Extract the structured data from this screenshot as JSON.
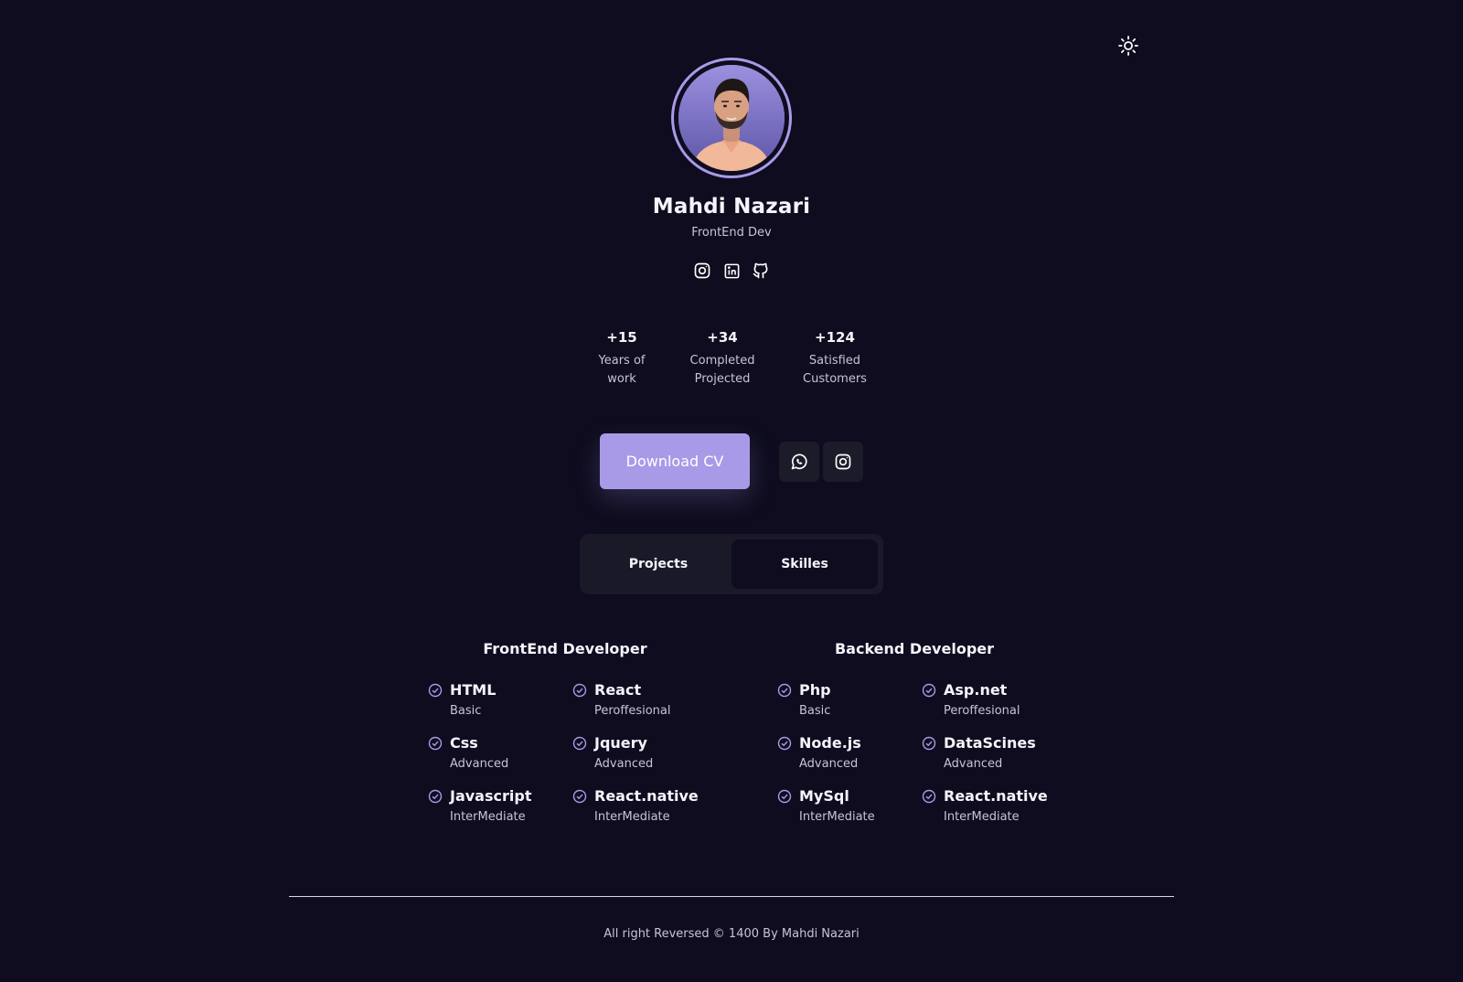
{
  "header": {
    "theme_icon": "sun-icon"
  },
  "profile": {
    "name": "Mahdi Nazari",
    "role": "FrontEnd Dev",
    "social_icons": [
      "instagram-icon",
      "linkedin-icon",
      "github-icon"
    ]
  },
  "stats": [
    {
      "value": "+15",
      "label_line1": "Years of",
      "label_line2": "work"
    },
    {
      "value": "+34",
      "label_line1": "Completed",
      "label_line2": "Projected"
    },
    {
      "value": "+124",
      "label_line1": "Satisfied",
      "label_line2": "Customers"
    }
  ],
  "actions": {
    "download_label": "Download CV",
    "whatsapp_icon": "whatsapp-icon",
    "instagram_icon": "instagram-icon"
  },
  "tabs": [
    {
      "label": "Projects",
      "active": false
    },
    {
      "label": "Skilles",
      "active": true
    }
  ],
  "skills": {
    "frontend": {
      "title": "FrontEnd Developer",
      "items": [
        {
          "name": "HTML",
          "level": "Basic"
        },
        {
          "name": "React",
          "level": "Peroffesional"
        },
        {
          "name": "Css",
          "level": "Advanced"
        },
        {
          "name": "Jquery",
          "level": "Advanced"
        },
        {
          "name": "Javascript",
          "level": "InterMediate"
        },
        {
          "name": "React.native",
          "level": "InterMediate"
        }
      ]
    },
    "backend": {
      "title": "Backend Developer",
      "items": [
        {
          "name": "Php",
          "level": "Basic"
        },
        {
          "name": "Asp.net",
          "level": "Peroffesional"
        },
        {
          "name": "Node.js",
          "level": "Advanced"
        },
        {
          "name": "DataScines",
          "level": "Advanced"
        },
        {
          "name": "MySql",
          "level": "InterMediate"
        },
        {
          "name": "React.native",
          "level": "InterMediate"
        }
      ]
    }
  },
  "footer": {
    "text": "All right Reversed © 1400 By Mahdi Nazari"
  },
  "colors": {
    "background": "#0e0c1e",
    "accent": "#a99ae8",
    "card": "#1a1928",
    "text": "#f5f4fb",
    "muted_text": "#c6c4d6"
  }
}
